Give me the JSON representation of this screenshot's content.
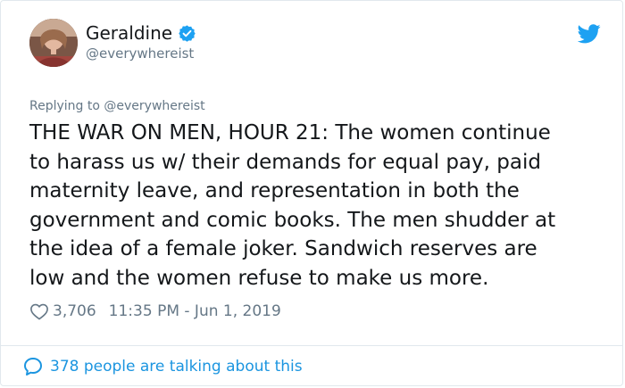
{
  "user": {
    "name": "Geraldine",
    "handle": "@everywhereist",
    "verified": true
  },
  "reply_to": {
    "prefix": "Replying to",
    "mention": "@everywhereist"
  },
  "tweet": {
    "lines": [
      "THE WAR ON MEN, HOUR 21: The women continue",
      "to harass us w/ their demands for equal pay, paid",
      "maternity leave, and representation in both the",
      "government and comic books. The men shudder at",
      "the idea of a female joker. Sandwich reserves are",
      "low and the women refuse to make us more."
    ]
  },
  "meta": {
    "likes": "3,706",
    "timestamp": "11:35 PM - Jun 1, 2019"
  },
  "footer": {
    "talking": "378 people are talking about this"
  },
  "icons": {
    "verified": "verified-badge-icon",
    "bird": "twitter-bird-icon",
    "heart": "heart-icon",
    "bubble": "speech-bubble-icon"
  },
  "colors": {
    "twitter_blue": "#1da1f2",
    "link_blue": "#1b95e0",
    "muted": "#657786",
    "text": "#14171a"
  }
}
